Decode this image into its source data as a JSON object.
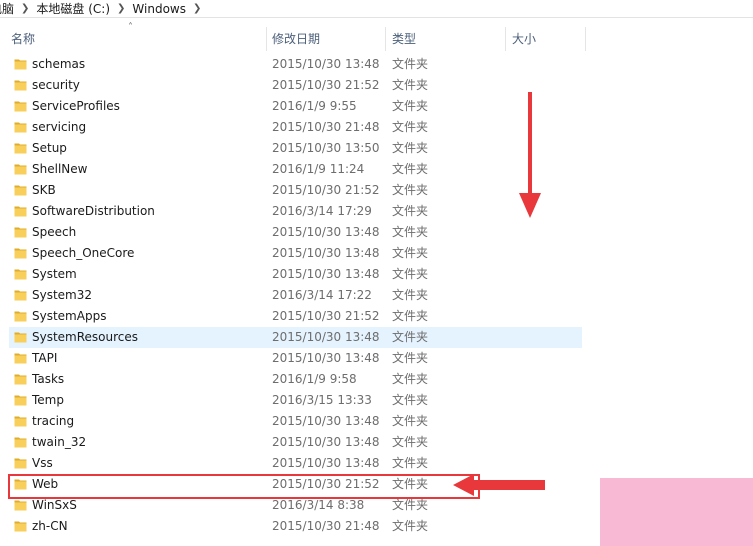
{
  "address_bar": {
    "segments": [
      "电脑",
      "本地磁盘 (C:)",
      "Windows"
    ]
  },
  "columns": {
    "name": "名称",
    "date": "修改日期",
    "type": "类型",
    "size": "大小"
  },
  "selected_row": "SystemResources",
  "highlighted_row": "Web",
  "rows": [
    {
      "name": "schemas",
      "date": "2015/10/30 13:48",
      "type": "文件夹"
    },
    {
      "name": "security",
      "date": "2015/10/30 21:52",
      "type": "文件夹"
    },
    {
      "name": "ServiceProfiles",
      "date": "2016/1/9 9:55",
      "type": "文件夹"
    },
    {
      "name": "servicing",
      "date": "2015/10/30 21:48",
      "type": "文件夹"
    },
    {
      "name": "Setup",
      "date": "2015/10/30 13:50",
      "type": "文件夹"
    },
    {
      "name": "ShellNew",
      "date": "2016/1/9 11:24",
      "type": "文件夹"
    },
    {
      "name": "SKB",
      "date": "2015/10/30 21:52",
      "type": "文件夹"
    },
    {
      "name": "SoftwareDistribution",
      "date": "2016/3/14 17:29",
      "type": "文件夹"
    },
    {
      "name": "Speech",
      "date": "2015/10/30 13:48",
      "type": "文件夹"
    },
    {
      "name": "Speech_OneCore",
      "date": "2015/10/30 13:48",
      "type": "文件夹"
    },
    {
      "name": "System",
      "date": "2015/10/30 13:48",
      "type": "文件夹"
    },
    {
      "name": "System32",
      "date": "2016/3/14 17:22",
      "type": "文件夹"
    },
    {
      "name": "SystemApps",
      "date": "2015/10/30 21:52",
      "type": "文件夹"
    },
    {
      "name": "SystemResources",
      "date": "2015/10/30 13:48",
      "type": "文件夹"
    },
    {
      "name": "TAPI",
      "date": "2015/10/30 13:48",
      "type": "文件夹"
    },
    {
      "name": "Tasks",
      "date": "2016/1/9 9:58",
      "type": "文件夹"
    },
    {
      "name": "Temp",
      "date": "2016/3/15 13:33",
      "type": "文件夹"
    },
    {
      "name": "tracing",
      "date": "2015/10/30 13:48",
      "type": "文件夹"
    },
    {
      "name": "twain_32",
      "date": "2015/10/30 13:48",
      "type": "文件夹"
    },
    {
      "name": "Vss",
      "date": "2015/10/30 13:48",
      "type": "文件夹"
    },
    {
      "name": "Web",
      "date": "2015/10/30 21:52",
      "type": "文件夹"
    },
    {
      "name": "WinSxS",
      "date": "2016/3/14 8:38",
      "type": "文件夹"
    },
    {
      "name": "zh-CN",
      "date": "2015/10/30 21:48",
      "type": "文件夹"
    }
  ],
  "colors": {
    "folder": "#f7cf5a",
    "folder_dark": "#e0ac2b",
    "selection": "#e5f3ff",
    "annotation_red": "#e8383b",
    "corner_pink": "#f7b9d4"
  },
  "icons": {
    "folder": "folder-icon",
    "sort": "sort-ascending-icon",
    "breadcrumb_separator": "chevron-right-icon"
  }
}
